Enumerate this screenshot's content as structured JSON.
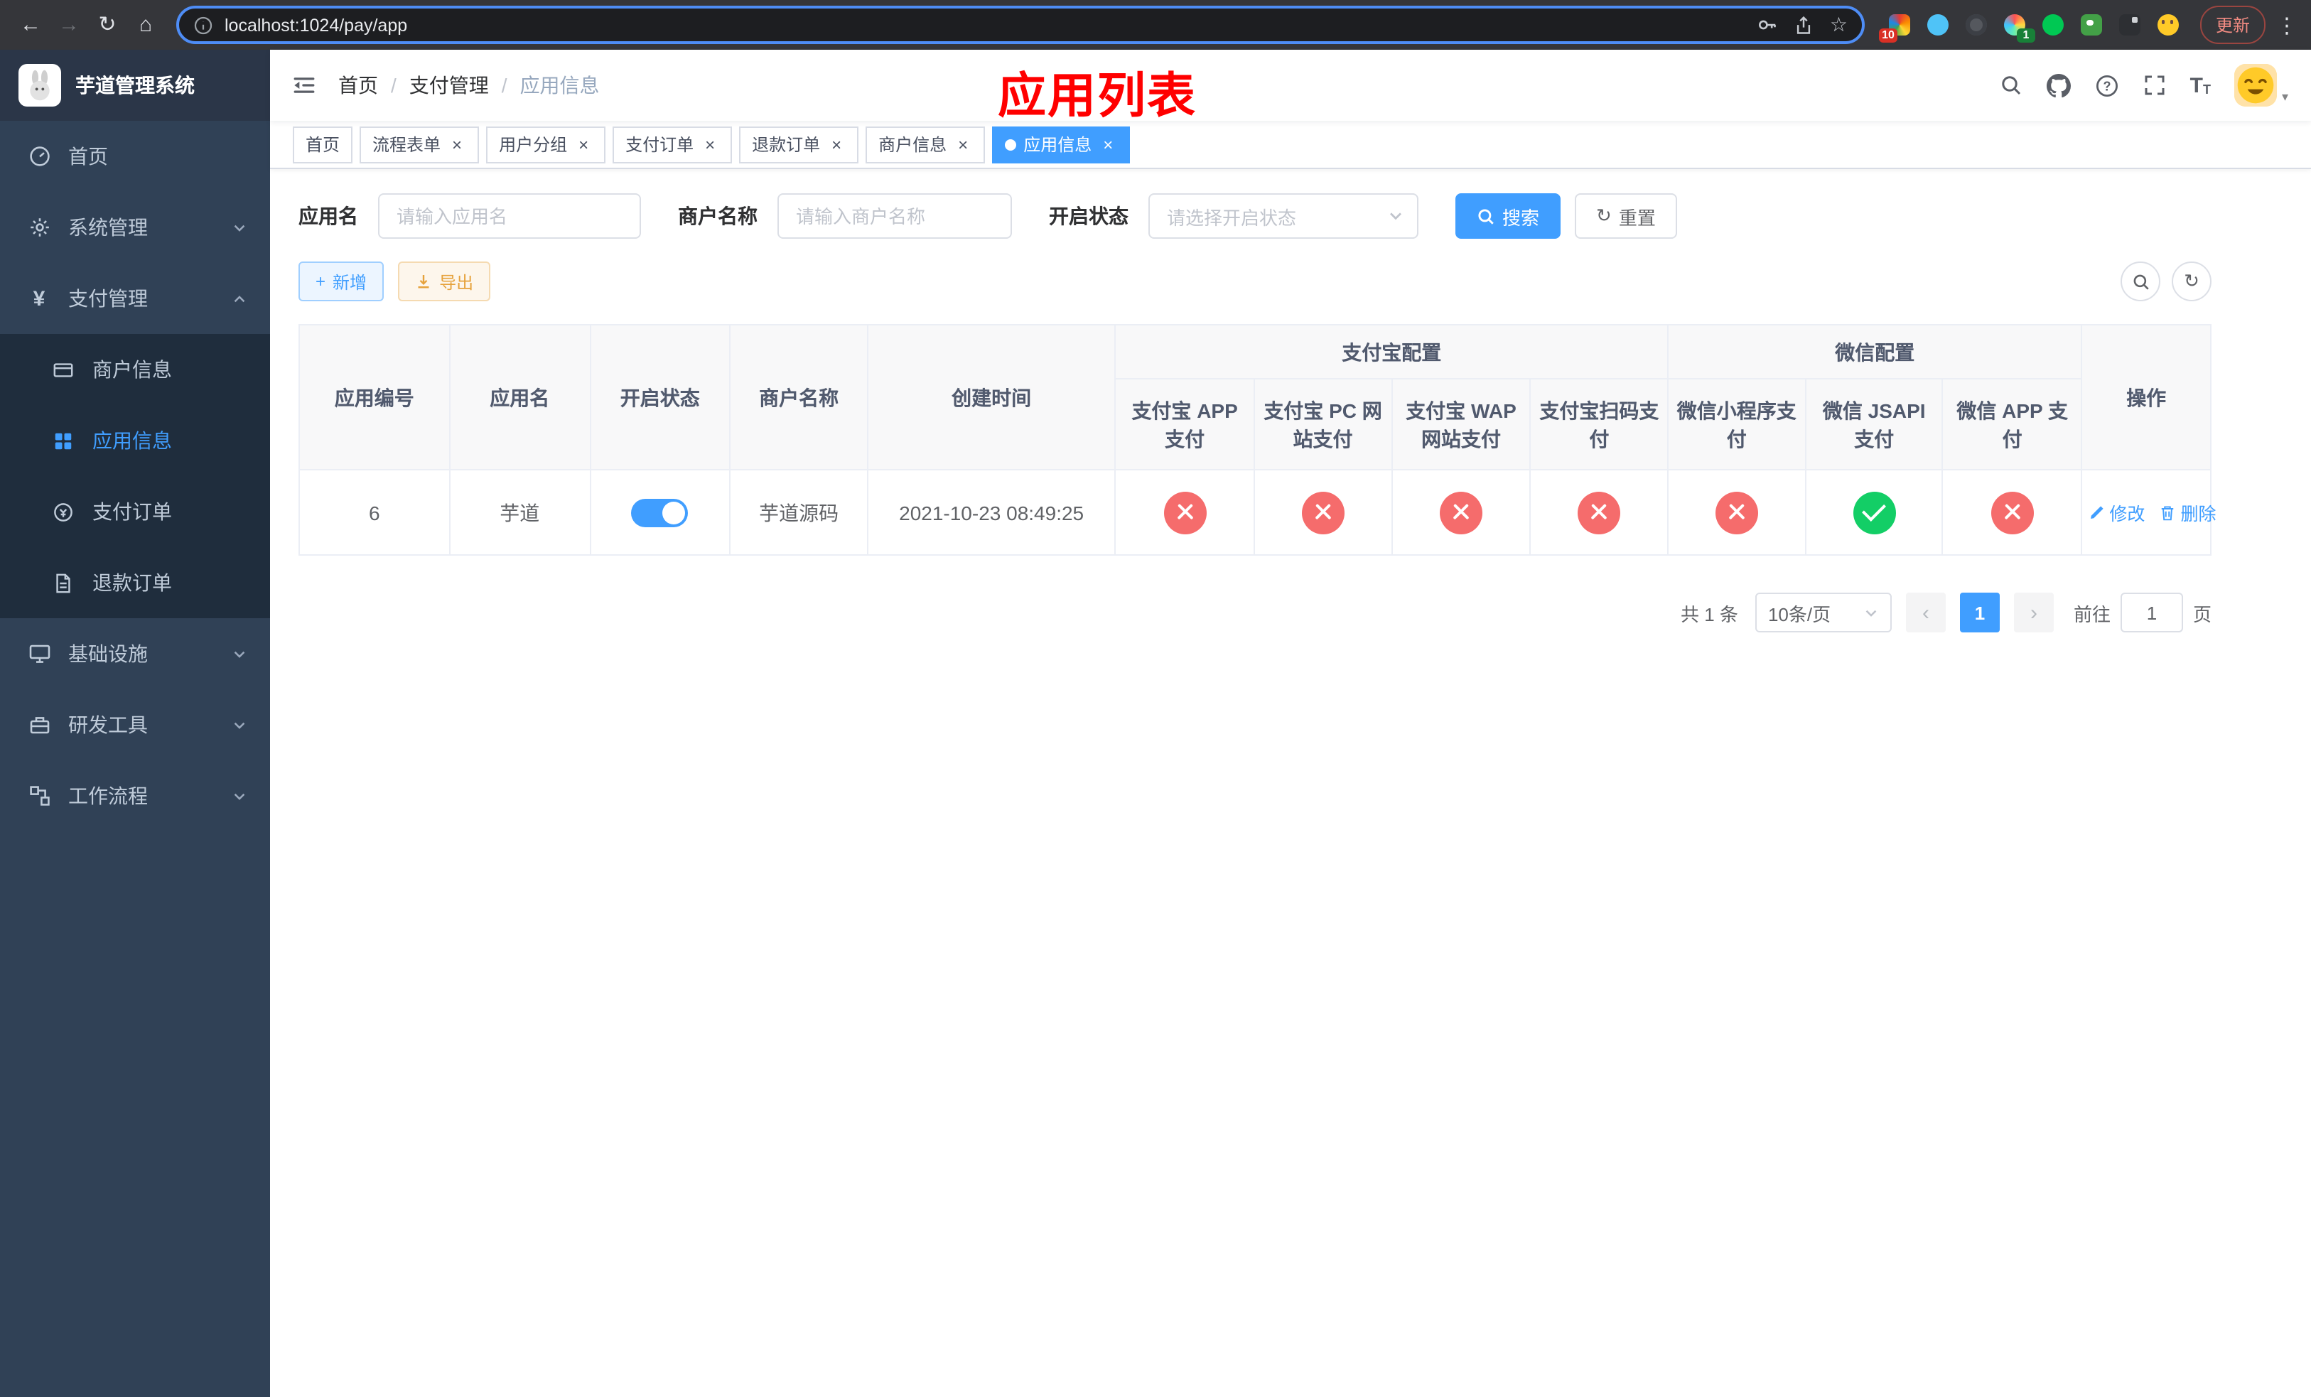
{
  "colors": {
    "primary": "#409eff",
    "danger": "#f56c6c",
    "success": "#13ce66",
    "warning": "#e6a23c",
    "annotation": "#ff0000"
  },
  "icons": {
    "back": "←",
    "forward": "→",
    "reload": "↻",
    "home": "⌂",
    "star": "☆",
    "menu_dots": "⋮",
    "caret_down": "▾",
    "prev": "‹",
    "next": "›",
    "close": "×",
    "plus": "+",
    "text_size_big": "T",
    "text_size_small": "T",
    "yen": "¥",
    "breadcrumb_sep": "/"
  },
  "browser": {
    "url": "localhost:1024/pay/app",
    "update_button": "更新",
    "badge_red": "10",
    "badge_green": "1"
  },
  "sidebar": {
    "title": "芋道管理系统",
    "items": [
      {
        "label": "首页"
      },
      {
        "label": "系统管理"
      },
      {
        "label": "支付管理"
      },
      {
        "label": "基础设施"
      },
      {
        "label": "研发工具"
      },
      {
        "label": "工作流程"
      }
    ],
    "submenu": [
      {
        "label": "商户信息"
      },
      {
        "label": "应用信息"
      },
      {
        "label": "支付订单"
      },
      {
        "label": "退款订单"
      }
    ]
  },
  "header": {
    "breadcrumb": [
      "首页",
      "支付管理",
      "应用信息"
    ],
    "annotation": "应用列表"
  },
  "tabs": [
    {
      "label": "首页"
    },
    {
      "label": "流程表单"
    },
    {
      "label": "用户分组"
    },
    {
      "label": "支付订单"
    },
    {
      "label": "退款订单"
    },
    {
      "label": "商户信息"
    },
    {
      "label": "应用信息"
    }
  ],
  "filters": {
    "app_name": {
      "label": "应用名",
      "placeholder": "请输入应用名",
      "value": ""
    },
    "merchant_name": {
      "label": "商户名称",
      "placeholder": "请输入商户名称",
      "value": ""
    },
    "status": {
      "label": "开启状态",
      "placeholder": "请选择开启状态",
      "value": ""
    },
    "search": "搜索",
    "reset": "重置"
  },
  "toolbar": {
    "add": "新增",
    "export": "导出"
  },
  "table": {
    "groups": {
      "alipay": "支付宝配置",
      "wechat": "微信配置"
    },
    "columns": {
      "id": "应用编号",
      "name": "应用名",
      "status": "开启状态",
      "merchant": "商户名称",
      "created": "创建时间",
      "alipay_app": "支付宝 APP 支付",
      "alipay_pc": "支付宝 PC 网站支付",
      "alipay_wap": "支付宝 WAP 网站支付",
      "alipay_qr": "支付宝扫码支付",
      "wx_lite": "微信小程序支付",
      "wx_jsapi": "微信 JSAPI 支付",
      "wx_app": "微信 APP 支付",
      "actions": "操作"
    },
    "rows": [
      {
        "id": "6",
        "name": "芋道",
        "status_on": true,
        "merchant": "芋道源码",
        "created": "2021-10-23 08:49:25",
        "pay_channels": [
          false,
          false,
          false,
          false,
          false,
          true,
          false
        ],
        "actions": {
          "edit": "修改",
          "delete": "删除"
        }
      }
    ]
  },
  "pagination": {
    "total": "共 1 条",
    "page_size": "10条/页",
    "page": "1",
    "goto_label": "前往",
    "goto_unit": "页",
    "goto_value": "1"
  }
}
